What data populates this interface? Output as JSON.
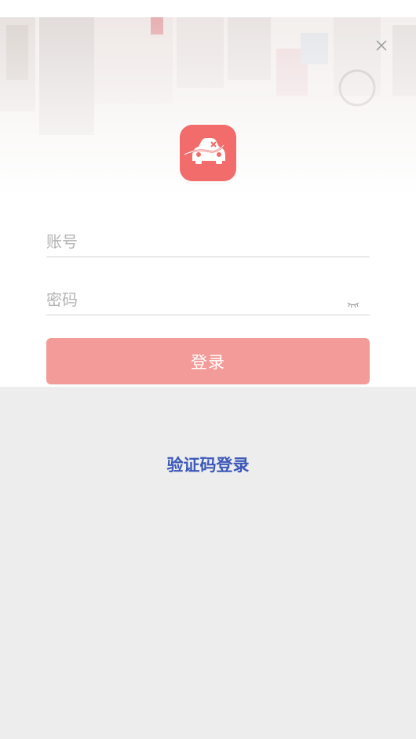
{
  "login": {
    "account_placeholder": "账号",
    "password_placeholder": "密码",
    "submit_label": "登录"
  },
  "alt_login": {
    "sms_label": "验证码登录"
  },
  "colors": {
    "brand": "#f16c6b",
    "button": "#f29b98",
    "link": "#3b58b8",
    "background": "#ededed"
  },
  "icons": [
    "close-icon",
    "app-logo-car-icon",
    "eye-closed-icon"
  ]
}
